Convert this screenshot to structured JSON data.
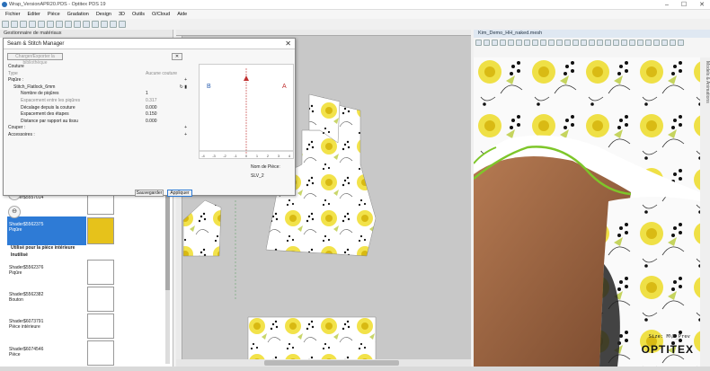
{
  "window": {
    "title": "Wrap_VersionAPR20.PDS - Optitex PDS 19"
  },
  "menu": [
    "Fichier",
    "Editer",
    "Pièce",
    "Gradation",
    "Design",
    "3D",
    "Outils",
    "O/Cloud",
    "Aide"
  ],
  "left_panel": {
    "title": "Gestionnaire de matériaux",
    "entries": [
      {
        "name": "Shader$5557014",
        "type": ""
      },
      {
        "name": "Shader$5562375",
        "type": "Piqûre"
      },
      {
        "name": "Shader$5562376",
        "type": "Piqûre"
      },
      {
        "name": "Shader$5562382",
        "type": "Bouton"
      },
      {
        "name": "Shader$6073791",
        "type": "Pièce intérieure"
      },
      {
        "name": "Shader$6074546",
        "type": "Pièce"
      }
    ],
    "section_interior": "Utilisé pour la pièce intérieure",
    "section_unused": "Inutilisé"
  },
  "dialog": {
    "title": "Seam & Stitch Manager",
    "load_button": "Charger/Exporter la bibliothèque",
    "tree": {
      "couture": "Couture",
      "type_label": "Type",
      "type_value": "Aucune couture",
      "piqure": "Piqûre :",
      "stitch_name": "Stitch_Flatlock_6mm",
      "nb_label": "Nombre de piqûres",
      "nb_value": "1",
      "esp_label": "Espacement entre les piqûres",
      "esp_value": "0.317",
      "dec_label": "Décalage depuis la couture",
      "dec_value": "0.000",
      "etapes_label": "Espacement des étapes",
      "etapes_value": "0.150",
      "dist_label": "Distance par rapport au tissu",
      "dist_value": "0.000",
      "couper": "Couper :",
      "accessoires": "Accessoires :"
    },
    "chart": {
      "label_b": "B",
      "label_a": "A",
      "ticks": [
        "-4",
        "-3",
        "-2",
        "-1",
        "0",
        "1",
        "2",
        "3",
        "4"
      ]
    },
    "piece_label": "Nom de Pièce:",
    "piece_name": "SLV_2",
    "save_button": "Sauvegarder",
    "apply_button": "Appliquer"
  },
  "right_view": {
    "title": "Kim_Demo_HH_naked.mesh",
    "size_text": "Size: M\\B_Prev",
    "brand": "OPTITEX",
    "side_label": "Models & Animations"
  },
  "colors": {
    "accent_blue": "#2e7bd6",
    "swatch_yellow": "#e6c21b",
    "seam_green": "#7ec62a",
    "skin": "#a06a47"
  }
}
